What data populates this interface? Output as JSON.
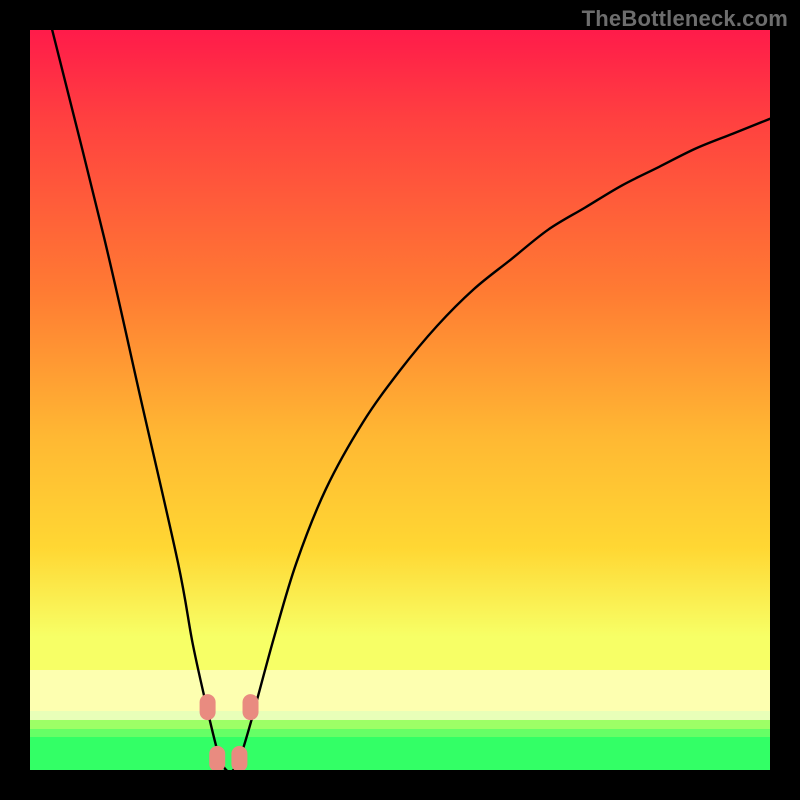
{
  "watermark": "TheBottleneck.com",
  "colors": {
    "bg": "#000000",
    "grad_top": "#ff1b4a",
    "grad_mid1": "#ff7a33",
    "grad_mid2": "#ffd733",
    "grad_near_bottom": "#f7ff66",
    "sat_yellow": "#fdffb0",
    "sat_green1": "#9dff66",
    "sat_green2": "#33ff66",
    "sat_green3": "#00e05a",
    "curve": "#000000",
    "marker_fill": "#e98b80",
    "marker_stroke": "#c46257"
  },
  "chart_data": {
    "type": "line",
    "title": "",
    "xlabel": "",
    "ylabel": "",
    "xlim": [
      0,
      100
    ],
    "ylim": [
      0,
      100
    ],
    "x": [
      3,
      10,
      15,
      20,
      22,
      24,
      25.5,
      26.5,
      27.5,
      28.5,
      30,
      33,
      36,
      40,
      45,
      50,
      55,
      60,
      65,
      70,
      75,
      80,
      85,
      90,
      95,
      100
    ],
    "y": [
      100,
      72,
      50,
      28,
      17,
      8,
      2,
      0,
      0,
      2,
      7,
      18,
      28,
      38,
      47,
      54,
      60,
      65,
      69,
      73,
      76,
      79,
      81.5,
      84,
      86,
      88
    ],
    "annotations": [
      {
        "x": 24.0,
        "y": 8.5
      },
      {
        "x": 25.3,
        "y": 1.5
      },
      {
        "x": 28.3,
        "y": 1.5
      },
      {
        "x": 29.8,
        "y": 8.5
      }
    ]
  }
}
